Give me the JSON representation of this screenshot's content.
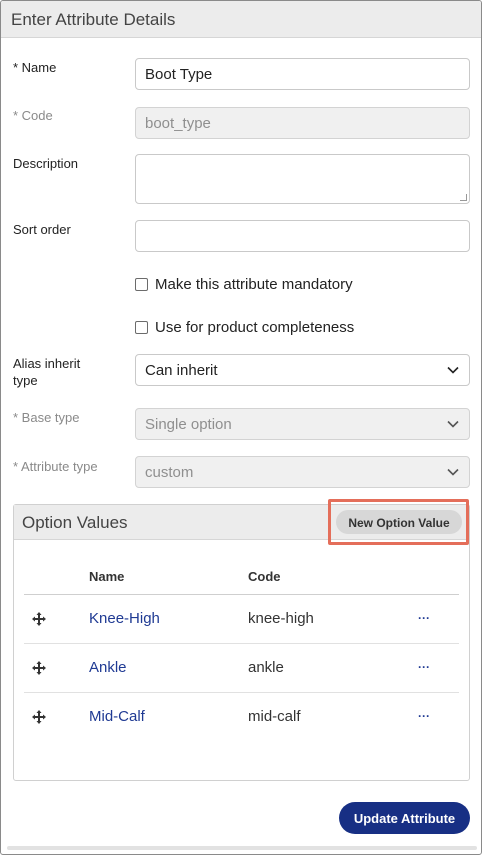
{
  "panel": {
    "title": "Enter Attribute Details"
  },
  "form": {
    "name": {
      "label": "* Name",
      "value": "Boot Type"
    },
    "code": {
      "label": "* Code",
      "value": "boot_type"
    },
    "description": {
      "label": "Description",
      "value": ""
    },
    "sort_order": {
      "label": "Sort order",
      "value": ""
    },
    "mandatory": {
      "label": "Make this attribute mandatory",
      "checked": false
    },
    "completeness": {
      "label": "Use for product completeness",
      "checked": false
    },
    "alias_inherit": {
      "label_line1": "Alias inherit",
      "label_line2": "type",
      "value": "Can inherit"
    },
    "base_type": {
      "label": "* Base type",
      "value": "Single option"
    },
    "attribute_type": {
      "label": "* Attribute type",
      "value": "custom"
    }
  },
  "option_values": {
    "title": "Option Values",
    "new_button": "New Option Value",
    "columns": {
      "name": "Name",
      "code": "Code"
    },
    "rows": [
      {
        "name": "Knee-High",
        "code": "knee-high",
        "more": "···"
      },
      {
        "name": "Ankle",
        "code": "ankle",
        "more": "···"
      },
      {
        "name": "Mid-Calf",
        "code": "mid-calf",
        "more": "···"
      }
    ]
  },
  "actions": {
    "update": "Update Attribute"
  },
  "colors": {
    "primary": "#172f84",
    "link": "#1f3a93",
    "highlight": "#e46e5a"
  },
  "icons": {
    "row_handle": "move-icon",
    "row_menu": "more-icon",
    "select_caret": "chevron-down-icon"
  }
}
